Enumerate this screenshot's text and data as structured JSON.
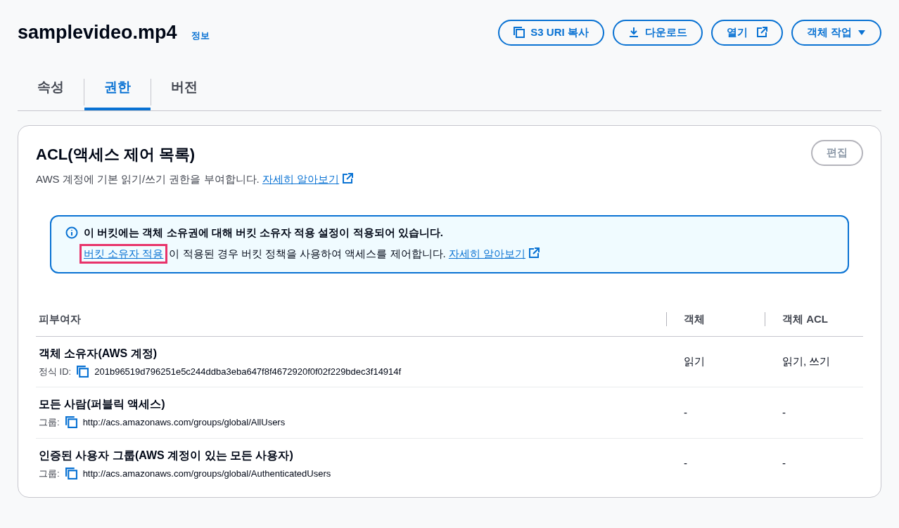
{
  "header": {
    "title": "samplevideo.mp4",
    "info_link": "정보",
    "buttons": [
      {
        "kind": "copy",
        "label": "S3 URI 복사"
      },
      {
        "kind": "download",
        "label": "다운로드"
      },
      {
        "kind": "external",
        "label": "열기"
      },
      {
        "kind": "dropdown",
        "label": "객체 작업"
      }
    ]
  },
  "tabs": [
    {
      "label": "속성",
      "selected": false
    },
    {
      "label": "권한",
      "selected": true
    },
    {
      "label": "버전",
      "selected": false
    }
  ],
  "panel": {
    "title": "ACL(액세스 제어 목록)",
    "edit_button": {
      "label": "편집",
      "disabled": true
    },
    "description": "AWS 계정에 기본 읽기/쓰기 권한을 부여합니다.",
    "learn_more": "자세히 알아보기",
    "alert": {
      "heading": "이 버킷에는 객체 소유권에 대해 버킷 소유자 적용 설정이 적용되어 있습니다.",
      "link": "버킷 소유자 적용",
      "link_highlighted": true,
      "text": "이 적용된 경우 버킷 정책을 사용하여 액세스를 제어합니다.",
      "learn_more": "자세히 알아보기"
    },
    "table": {
      "columns": [
        "피부여자",
        "객체",
        "객체 ACL"
      ],
      "rows": [
        {
          "grantee": "객체 소유자(AWS 계정)",
          "id_label": "정식 ID:",
          "id_value": "201b96519d796251e5c244ddba3eba647f8f4672920f0f02f229bdec3f14914f",
          "object": "읽기",
          "object_acl": "읽기, 쓰기"
        },
        {
          "grantee": "모든 사람(퍼블릭 액세스)",
          "id_label": "그룹:",
          "id_value": "http://acs.amazonaws.com/groups/global/AllUsers",
          "object": "-",
          "object_acl": "-"
        },
        {
          "grantee": "인증된 사용자 그룹(AWS 계정이 있는 모든 사용자)",
          "id_label": "그룹:",
          "id_value": "http://acs.amazonaws.com/groups/global/AuthenticatedUsers",
          "object": "-",
          "object_acl": "-"
        }
      ]
    }
  }
}
